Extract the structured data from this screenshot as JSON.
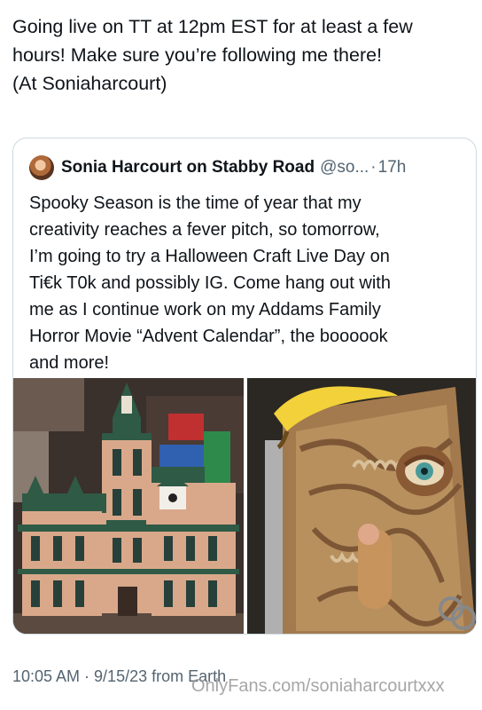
{
  "tweet": {
    "text_line1": "Going live on TT at 12pm EST for at least a few",
    "text_line2": "hours! Make sure you’re following me there!",
    "text_line3": "(At Soniaharcourt)",
    "timestamp": "10:05 AM · 9/15/23 from Earth"
  },
  "quote": {
    "author_name": "Sonia Harcourt on Stabby Road",
    "handle": "@so...",
    "separator": "·",
    "time": "17h",
    "lines": [
      "Spooky Season is the time of year that my",
      "creativity reaches a fever pitch, so tomorrow,",
      "I’m going to try a Halloween Craft Live Day on",
      "Ti€k T0k and possibly IG. Come hang out with",
      "me as I continue work on my Addams Family",
      "Horror Movie “Advent Calendar”, the boooook",
      "and more!"
    ]
  },
  "watermark": "OnlyFans.com/soniaharcourtxxx",
  "colors": {
    "text": "#0f1419",
    "secondary": "#536471",
    "border": "#cfd9de"
  }
}
